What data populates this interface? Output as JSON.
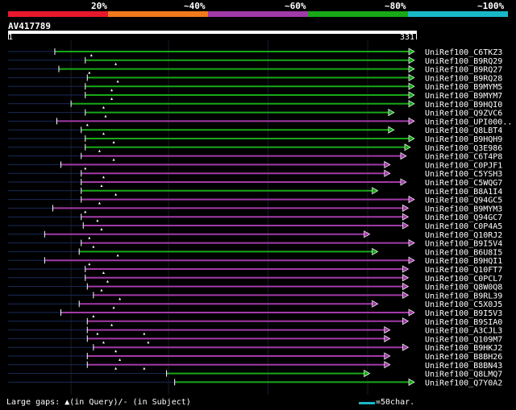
{
  "legend": {
    "labels": [
      "20%",
      "~40%",
      "~60%",
      "~80%",
      "~100%"
    ],
    "colors": [
      "#e8182c",
      "#f07a1c",
      "#a23aa8",
      "#18a818",
      "#18b8c8"
    ]
  },
  "query": {
    "id": "AV417789",
    "start": "1",
    "end": "331"
  },
  "hits": [
    {
      "name": "UniRef100_C6TKZ3",
      "color": "green",
      "start": 0.115,
      "end": 1.0,
      "markers": [
        0.205
      ]
    },
    {
      "name": "UniRef100_B9RQ29",
      "color": "green",
      "start": 0.19,
      "end": 1.0,
      "markers": [
        0.265
      ]
    },
    {
      "name": "UniRef100_B9RQ27",
      "color": "green",
      "start": 0.125,
      "end": 1.0,
      "markers": [
        0.2
      ]
    },
    {
      "name": "UniRef100_B9RQ28",
      "color": "green",
      "start": 0.195,
      "end": 1.0,
      "markers": [
        0.27
      ]
    },
    {
      "name": "UniRef100_B9MYM5",
      "color": "green",
      "start": 0.19,
      "end": 1.0,
      "markers": [
        0.255
      ]
    },
    {
      "name": "UniRef100_B9MYM7",
      "color": "green",
      "start": 0.19,
      "end": 1.0,
      "markers": [
        0.255
      ]
    },
    {
      "name": "UniRef100_B9HQI0",
      "color": "green",
      "start": 0.155,
      "end": 1.0,
      "markers": [
        0.235
      ]
    },
    {
      "name": "UniRef100_Q9ZVC6",
      "color": "green",
      "start": 0.19,
      "end": 0.95,
      "markers": [
        0.24
      ]
    },
    {
      "name": "UniRef100_UPI000..",
      "color": "purple",
      "start": 0.12,
      "end": 1.0,
      "markers": [
        0.195
      ]
    },
    {
      "name": "UniRef100_Q8LBT4",
      "color": "green",
      "start": 0.18,
      "end": 0.95,
      "markers": [
        0.235
      ]
    },
    {
      "name": "UniRef100_B9HQH9",
      "color": "green",
      "start": 0.19,
      "end": 1.0,
      "markers": [
        0.26
      ]
    },
    {
      "name": "UniRef100_Q3E986",
      "color": "green",
      "start": 0.19,
      "end": 0.99,
      "markers": [
        0.225
      ]
    },
    {
      "name": "UniRef100_C6T4P8",
      "color": "purple",
      "start": 0.18,
      "end": 0.98,
      "markers": [
        0.26
      ]
    },
    {
      "name": "UniRef100_C0PJF1",
      "color": "purple",
      "start": 0.13,
      "end": 0.94,
      "markers": [
        0.19
      ]
    },
    {
      "name": "UniRef100_C5YSH3",
      "color": "purple",
      "start": 0.18,
      "end": 0.94,
      "markers": [
        0.235
      ]
    },
    {
      "name": "UniRef100_C5WQG7",
      "color": "purple",
      "start": 0.18,
      "end": 0.98,
      "markers": [
        0.23
      ]
    },
    {
      "name": "UniRef100_B8A1I4",
      "color": "green",
      "start": 0.18,
      "end": 0.91,
      "markers": [
        0.265
      ]
    },
    {
      "name": "UniRef100_Q94GC5",
      "color": "purple",
      "start": 0.18,
      "end": 1.0,
      "markers": [
        0.225
      ]
    },
    {
      "name": "UniRef100_B9MYM3",
      "color": "purple",
      "start": 0.11,
      "end": 0.985,
      "markers": [
        0.19
      ]
    },
    {
      "name": "UniRef100_Q94GC7",
      "color": "purple",
      "start": 0.18,
      "end": 0.985,
      "markers": [
        0.22
      ]
    },
    {
      "name": "UniRef100_C0P4A5",
      "color": "purple",
      "start": 0.185,
      "end": 0.985,
      "markers": [
        0.23
      ]
    },
    {
      "name": "UniRef100_Q10RJ2",
      "color": "purple",
      "start": 0.09,
      "end": 0.89,
      "markers": [
        0.2
      ]
    },
    {
      "name": "UniRef100_B9I5V4",
      "color": "purple",
      "start": 0.18,
      "end": 1.0,
      "markers": [
        0.21
      ]
    },
    {
      "name": "UniRef100_B6U8I5",
      "color": "green",
      "start": 0.175,
      "end": 0.91,
      "markers": [
        0.27
      ]
    },
    {
      "name": "UniRef100_B9HQI1",
      "color": "purple",
      "start": 0.09,
      "end": 1.0,
      "markers": [
        0.2
      ]
    },
    {
      "name": "UniRef100_Q10FT7",
      "color": "purple",
      "start": 0.19,
      "end": 0.985,
      "markers": [
        0.235
      ]
    },
    {
      "name": "UniRef100_C0PCL7",
      "color": "purple",
      "start": 0.19,
      "end": 0.985,
      "markers": [
        0.245
      ]
    },
    {
      "name": "UniRef100_Q8W0Q8",
      "color": "purple",
      "start": 0.195,
      "end": 0.985,
      "markers": [
        0.23
      ]
    },
    {
      "name": "UniRef100_B9RL39",
      "color": "purple",
      "start": 0.21,
      "end": 0.985,
      "markers": [
        0.275
      ]
    },
    {
      "name": "UniRef100_C5X0J5",
      "color": "purple",
      "start": 0.175,
      "end": 0.91,
      "markers": [
        0.26
      ]
    },
    {
      "name": "UniRef100_B9I5V3",
      "color": "purple",
      "start": 0.13,
      "end": 1.0,
      "markers": [
        0.21
      ]
    },
    {
      "name": "UniRef100_B9SIA0",
      "color": "purple",
      "start": 0.195,
      "end": 0.985,
      "markers": [
        0.255
      ]
    },
    {
      "name": "UniRef100_A3CJL3",
      "color": "purple",
      "start": 0.195,
      "end": 0.94,
      "markers": [
        0.22,
        0.335
      ]
    },
    {
      "name": "UniRef100_Q109M7",
      "color": "purple",
      "start": 0.195,
      "end": 0.94,
      "markers": [
        0.235,
        0.345
      ]
    },
    {
      "name": "UniRef100_B9HKJ2",
      "color": "purple",
      "start": 0.21,
      "end": 0.985,
      "markers": [
        0.265
      ]
    },
    {
      "name": "UniRef100_B8BH26",
      "color": "purple",
      "start": 0.195,
      "end": 0.94,
      "markers": [
        0.275
      ]
    },
    {
      "name": "UniRef100_B8BN43",
      "color": "purple",
      "start": 0.195,
      "end": 0.94,
      "markers": [
        0.265,
        0.335
      ]
    },
    {
      "name": "UniRef100_Q8LMQ7",
      "color": "green",
      "start": 0.39,
      "end": 0.89,
      "markers": []
    },
    {
      "name": "UniRef100_Q7Y0A2",
      "color": "green",
      "start": 0.41,
      "end": 1.0,
      "markers": []
    }
  ],
  "footer": {
    "text": "Large gaps: ▲(in Query)/- (in Subject)",
    "scale_label": "=50char.",
    "scale_color": "#18b8c8"
  },
  "colors": {
    "green": "#18a818",
    "purple": "#a23aa8",
    "gap_line": "#1a2a5a",
    "marker": "#ffffff"
  }
}
